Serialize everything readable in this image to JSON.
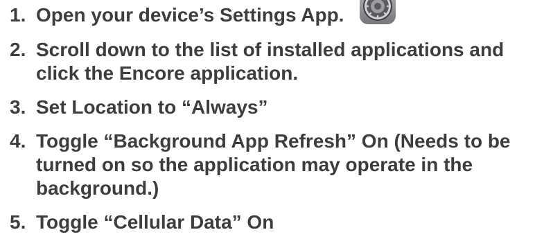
{
  "steps": [
    {
      "number": "1.",
      "text": "Open your device’s Settings App.",
      "icon": "settings-app-icon"
    },
    {
      "number": "2.",
      "text": "Scroll down to the list of installed applications and click the Encore application."
    },
    {
      "number": "3.",
      "text": "Set Location to “Always”"
    },
    {
      "number": "4.",
      "text": "Toggle “Background App Refresh” On (Needs to be turned on so the application may operate in the background.)"
    },
    {
      "number": "5.",
      "text": "Toggle “Cellular Data” On"
    }
  ],
  "colors": {
    "text": "#3d3d3d",
    "icon_background": "#8e8e93",
    "icon_gear": "#5a5a5e"
  }
}
